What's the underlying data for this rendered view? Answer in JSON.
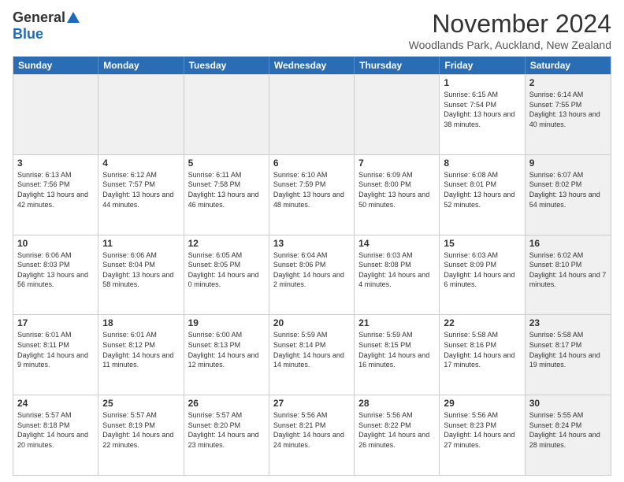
{
  "logo": {
    "line1": "General",
    "line2": "Blue"
  },
  "title": "November 2024",
  "location": "Woodlands Park, Auckland, New Zealand",
  "headers": [
    "Sunday",
    "Monday",
    "Tuesday",
    "Wednesday",
    "Thursday",
    "Friday",
    "Saturday"
  ],
  "rows": [
    [
      {
        "day": "",
        "info": "",
        "shaded": true
      },
      {
        "day": "",
        "info": "",
        "shaded": true
      },
      {
        "day": "",
        "info": "",
        "shaded": true
      },
      {
        "day": "",
        "info": "",
        "shaded": true
      },
      {
        "day": "",
        "info": "",
        "shaded": true
      },
      {
        "day": "1",
        "info": "Sunrise: 6:15 AM\nSunset: 7:54 PM\nDaylight: 13 hours\nand 38 minutes.",
        "shaded": false
      },
      {
        "day": "2",
        "info": "Sunrise: 6:14 AM\nSunset: 7:55 PM\nDaylight: 13 hours\nand 40 minutes.",
        "shaded": true
      }
    ],
    [
      {
        "day": "3",
        "info": "Sunrise: 6:13 AM\nSunset: 7:56 PM\nDaylight: 13 hours\nand 42 minutes.",
        "shaded": false
      },
      {
        "day": "4",
        "info": "Sunrise: 6:12 AM\nSunset: 7:57 PM\nDaylight: 13 hours\nand 44 minutes.",
        "shaded": false
      },
      {
        "day": "5",
        "info": "Sunrise: 6:11 AM\nSunset: 7:58 PM\nDaylight: 13 hours\nand 46 minutes.",
        "shaded": false
      },
      {
        "day": "6",
        "info": "Sunrise: 6:10 AM\nSunset: 7:59 PM\nDaylight: 13 hours\nand 48 minutes.",
        "shaded": false
      },
      {
        "day": "7",
        "info": "Sunrise: 6:09 AM\nSunset: 8:00 PM\nDaylight: 13 hours\nand 50 minutes.",
        "shaded": false
      },
      {
        "day": "8",
        "info": "Sunrise: 6:08 AM\nSunset: 8:01 PM\nDaylight: 13 hours\nand 52 minutes.",
        "shaded": false
      },
      {
        "day": "9",
        "info": "Sunrise: 6:07 AM\nSunset: 8:02 PM\nDaylight: 13 hours\nand 54 minutes.",
        "shaded": true
      }
    ],
    [
      {
        "day": "10",
        "info": "Sunrise: 6:06 AM\nSunset: 8:03 PM\nDaylight: 13 hours\nand 56 minutes.",
        "shaded": false
      },
      {
        "day": "11",
        "info": "Sunrise: 6:06 AM\nSunset: 8:04 PM\nDaylight: 13 hours\nand 58 minutes.",
        "shaded": false
      },
      {
        "day": "12",
        "info": "Sunrise: 6:05 AM\nSunset: 8:05 PM\nDaylight: 14 hours\nand 0 minutes.",
        "shaded": false
      },
      {
        "day": "13",
        "info": "Sunrise: 6:04 AM\nSunset: 8:06 PM\nDaylight: 14 hours\nand 2 minutes.",
        "shaded": false
      },
      {
        "day": "14",
        "info": "Sunrise: 6:03 AM\nSunset: 8:08 PM\nDaylight: 14 hours\nand 4 minutes.",
        "shaded": false
      },
      {
        "day": "15",
        "info": "Sunrise: 6:03 AM\nSunset: 8:09 PM\nDaylight: 14 hours\nand 6 minutes.",
        "shaded": false
      },
      {
        "day": "16",
        "info": "Sunrise: 6:02 AM\nSunset: 8:10 PM\nDaylight: 14 hours\nand 7 minutes.",
        "shaded": true
      }
    ],
    [
      {
        "day": "17",
        "info": "Sunrise: 6:01 AM\nSunset: 8:11 PM\nDaylight: 14 hours\nand 9 minutes.",
        "shaded": false
      },
      {
        "day": "18",
        "info": "Sunrise: 6:01 AM\nSunset: 8:12 PM\nDaylight: 14 hours\nand 11 minutes.",
        "shaded": false
      },
      {
        "day": "19",
        "info": "Sunrise: 6:00 AM\nSunset: 8:13 PM\nDaylight: 14 hours\nand 12 minutes.",
        "shaded": false
      },
      {
        "day": "20",
        "info": "Sunrise: 5:59 AM\nSunset: 8:14 PM\nDaylight: 14 hours\nand 14 minutes.",
        "shaded": false
      },
      {
        "day": "21",
        "info": "Sunrise: 5:59 AM\nSunset: 8:15 PM\nDaylight: 14 hours\nand 16 minutes.",
        "shaded": false
      },
      {
        "day": "22",
        "info": "Sunrise: 5:58 AM\nSunset: 8:16 PM\nDaylight: 14 hours\nand 17 minutes.",
        "shaded": false
      },
      {
        "day": "23",
        "info": "Sunrise: 5:58 AM\nSunset: 8:17 PM\nDaylight: 14 hours\nand 19 minutes.",
        "shaded": true
      }
    ],
    [
      {
        "day": "24",
        "info": "Sunrise: 5:57 AM\nSunset: 8:18 PM\nDaylight: 14 hours\nand 20 minutes.",
        "shaded": false
      },
      {
        "day": "25",
        "info": "Sunrise: 5:57 AM\nSunset: 8:19 PM\nDaylight: 14 hours\nand 22 minutes.",
        "shaded": false
      },
      {
        "day": "26",
        "info": "Sunrise: 5:57 AM\nSunset: 8:20 PM\nDaylight: 14 hours\nand 23 minutes.",
        "shaded": false
      },
      {
        "day": "27",
        "info": "Sunrise: 5:56 AM\nSunset: 8:21 PM\nDaylight: 14 hours\nand 24 minutes.",
        "shaded": false
      },
      {
        "day": "28",
        "info": "Sunrise: 5:56 AM\nSunset: 8:22 PM\nDaylight: 14 hours\nand 26 minutes.",
        "shaded": false
      },
      {
        "day": "29",
        "info": "Sunrise: 5:56 AM\nSunset: 8:23 PM\nDaylight: 14 hours\nand 27 minutes.",
        "shaded": false
      },
      {
        "day": "30",
        "info": "Sunrise: 5:55 AM\nSunset: 8:24 PM\nDaylight: 14 hours\nand 28 minutes.",
        "shaded": true
      }
    ]
  ]
}
